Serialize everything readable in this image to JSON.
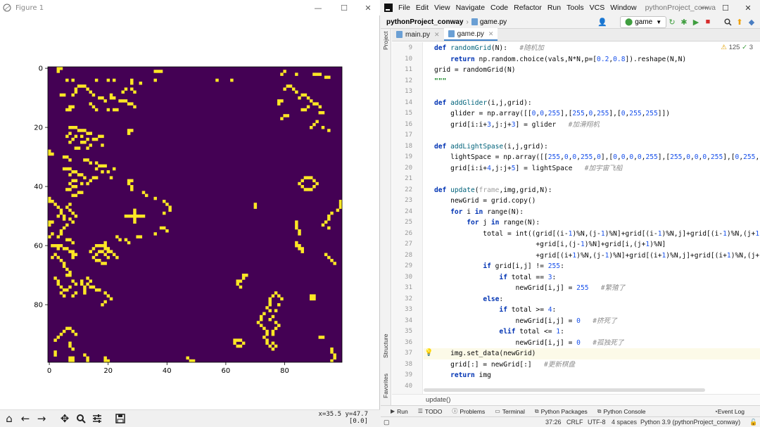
{
  "figure_window": {
    "title": "Figure 1",
    "controls": {
      "minimize": "—",
      "maximize": "☐",
      "close": "✕"
    },
    "toolbar_icons": [
      "home-icon",
      "back-icon",
      "forward-icon",
      "pan-icon",
      "zoom-icon",
      "configure-icon",
      "save-icon"
    ],
    "coords_line1": "x=35.5 y=47.7",
    "coords_line2": "[0.0]"
  },
  "chart_data": {
    "type": "heatmap",
    "description_colors": {
      "dead": "#440154",
      "alive": "#fde725"
    },
    "grid_size": 100,
    "xticks": [
      0,
      20,
      40,
      60,
      80
    ],
    "yticks": [
      0,
      20,
      40,
      60,
      80
    ],
    "xlim": [
      -0.5,
      99.5
    ],
    "ylim": [
      99.5,
      -0.5
    ],
    "alive_cells": [
      [
        0,
        3
      ],
      [
        0,
        4
      ],
      [
        1,
        3
      ],
      [
        4,
        6
      ],
      [
        4,
        8
      ],
      [
        4,
        16
      ],
      [
        4,
        20
      ],
      [
        4,
        22
      ],
      [
        4,
        28
      ],
      [
        4,
        36
      ],
      [
        4,
        57
      ],
      [
        4,
        62
      ],
      [
        1,
        36
      ],
      [
        1,
        37
      ],
      [
        1,
        38
      ],
      [
        1,
        80
      ],
      [
        2,
        79
      ],
      [
        2,
        84
      ],
      [
        2,
        90
      ],
      [
        2,
        91
      ],
      [
        2,
        92
      ],
      [
        3,
        94
      ],
      [
        3,
        95
      ],
      [
        5,
        28
      ],
      [
        5,
        31
      ],
      [
        6,
        10
      ],
      [
        6,
        11
      ],
      [
        6,
        12
      ],
      [
        7,
        9
      ],
      [
        7,
        13
      ],
      [
        7,
        26
      ],
      [
        7,
        28
      ],
      [
        8,
        9
      ],
      [
        8,
        14
      ],
      [
        8,
        25
      ],
      [
        8,
        29
      ],
      [
        9,
        4
      ],
      [
        9,
        5
      ],
      [
        9,
        8
      ],
      [
        9,
        15
      ],
      [
        9,
        21
      ],
      [
        10,
        17
      ],
      [
        10,
        18
      ],
      [
        10,
        21
      ],
      [
        10,
        22
      ],
      [
        11,
        19
      ],
      [
        11,
        24
      ],
      [
        11,
        25
      ],
      [
        11,
        26
      ],
      [
        12,
        14
      ],
      [
        12,
        27
      ],
      [
        12,
        28
      ],
      [
        13,
        7
      ],
      [
        13,
        8
      ],
      [
        13,
        15
      ],
      [
        13,
        29
      ],
      [
        14,
        6
      ],
      [
        14,
        7
      ],
      [
        14,
        16
      ],
      [
        14,
        20
      ],
      [
        14,
        22
      ],
      [
        14,
        23
      ],
      [
        6,
        81
      ],
      [
        6,
        82
      ],
      [
        7,
        80
      ],
      [
        7,
        83
      ],
      [
        8,
        84
      ],
      [
        9,
        86
      ],
      [
        9,
        87
      ],
      [
        10,
        85
      ],
      [
        10,
        88
      ],
      [
        11,
        78
      ],
      [
        11,
        79
      ],
      [
        11,
        89
      ],
      [
        12,
        78
      ],
      [
        12,
        90
      ],
      [
        12,
        91
      ],
      [
        13,
        88
      ],
      [
        13,
        92
      ],
      [
        14,
        87
      ],
      [
        14,
        86
      ],
      [
        15,
        92
      ],
      [
        15,
        93
      ],
      [
        16,
        80
      ],
      [
        16,
        81
      ],
      [
        17,
        79
      ],
      [
        20,
        7
      ],
      [
        20,
        8
      ],
      [
        20,
        9
      ],
      [
        21,
        10
      ],
      [
        21,
        11
      ],
      [
        21,
        12
      ],
      [
        22,
        7
      ],
      [
        22,
        13
      ],
      [
        22,
        14
      ],
      [
        23,
        6
      ],
      [
        23,
        9
      ],
      [
        23,
        11
      ],
      [
        24,
        8
      ],
      [
        24,
        13
      ],
      [
        24,
        15
      ],
      [
        24,
        16
      ],
      [
        25,
        7
      ],
      [
        25,
        11
      ],
      [
        25,
        12
      ],
      [
        26,
        14
      ],
      [
        26,
        18
      ],
      [
        27,
        9
      ],
      [
        27,
        10
      ],
      [
        27,
        13
      ],
      [
        21,
        27
      ],
      [
        21,
        28
      ],
      [
        22,
        27
      ],
      [
        23,
        17
      ],
      [
        23,
        18
      ],
      [
        18,
        91
      ],
      [
        19,
        90
      ],
      [
        20,
        89
      ],
      [
        20,
        93
      ],
      [
        21,
        95
      ],
      [
        28,
        0
      ],
      [
        29,
        0
      ],
      [
        29,
        1
      ],
      [
        30,
        5
      ],
      [
        30,
        6
      ],
      [
        31,
        7
      ],
      [
        31,
        12
      ],
      [
        31,
        13
      ],
      [
        32,
        14
      ],
      [
        32,
        16
      ],
      [
        33,
        17
      ],
      [
        33,
        18
      ],
      [
        33,
        19
      ],
      [
        34,
        5
      ],
      [
        34,
        6
      ],
      [
        34,
        7
      ],
      [
        34,
        16
      ],
      [
        34,
        22
      ],
      [
        35,
        8
      ],
      [
        35,
        9
      ],
      [
        35,
        18
      ],
      [
        35,
        20
      ],
      [
        36,
        7
      ],
      [
        36,
        10
      ],
      [
        36,
        11
      ],
      [
        37,
        12
      ],
      [
        37,
        15
      ],
      [
        37,
        16
      ],
      [
        37,
        21
      ],
      [
        38,
        8
      ],
      [
        38,
        9
      ],
      [
        38,
        14
      ],
      [
        39,
        7
      ],
      [
        39,
        11
      ],
      [
        39,
        13
      ],
      [
        40,
        8
      ],
      [
        40,
        9
      ],
      [
        41,
        6
      ],
      [
        41,
        7
      ],
      [
        42,
        10
      ],
      [
        42,
        11
      ],
      [
        43,
        8
      ],
      [
        43,
        9
      ],
      [
        37,
        87
      ],
      [
        37,
        88
      ],
      [
        37,
        89
      ],
      [
        38,
        86
      ],
      [
        38,
        90
      ],
      [
        39,
        85
      ],
      [
        39,
        91
      ],
      [
        40,
        86
      ],
      [
        40,
        90
      ],
      [
        41,
        87
      ],
      [
        41,
        88
      ],
      [
        41,
        89
      ],
      [
        38,
        27
      ],
      [
        38,
        28
      ],
      [
        39,
        27
      ],
      [
        40,
        28
      ],
      [
        41,
        28
      ],
      [
        42,
        32
      ],
      [
        43,
        33
      ],
      [
        44,
        36
      ],
      [
        45,
        39
      ],
      [
        46,
        40
      ],
      [
        47,
        41
      ],
      [
        48,
        41
      ],
      [
        49,
        39
      ],
      [
        44,
        0
      ],
      [
        45,
        0
      ],
      [
        45,
        1
      ],
      [
        46,
        2
      ],
      [
        47,
        3
      ],
      [
        48,
        4
      ],
      [
        49,
        4
      ],
      [
        50,
        3
      ],
      [
        50,
        5
      ],
      [
        51,
        5
      ],
      [
        52,
        0
      ],
      [
        52,
        1
      ],
      [
        53,
        0
      ],
      [
        46,
        7
      ],
      [
        47,
        6
      ],
      [
        48,
        7
      ],
      [
        49,
        8
      ],
      [
        50,
        9
      ],
      [
        51,
        7
      ],
      [
        52,
        8
      ],
      [
        53,
        6
      ],
      [
        54,
        5
      ],
      [
        55,
        4
      ],
      [
        56,
        4
      ],
      [
        57,
        3
      ],
      [
        48,
        29
      ],
      [
        49,
        29
      ],
      [
        50,
        29
      ],
      [
        51,
        29
      ],
      [
        52,
        29
      ],
      [
        50,
        26
      ],
      [
        50,
        27
      ],
      [
        50,
        28
      ],
      [
        50,
        30
      ],
      [
        50,
        31
      ],
      [
        50,
        32
      ],
      [
        45,
        99
      ],
      [
        46,
        99
      ],
      [
        47,
        99
      ],
      [
        48,
        98
      ],
      [
        49,
        96
      ],
      [
        50,
        95
      ],
      [
        51,
        95
      ],
      [
        52,
        94
      ],
      [
        53,
        93
      ],
      [
        54,
        95
      ],
      [
        46,
        70
      ],
      [
        47,
        70
      ],
      [
        52,
        84
      ],
      [
        53,
        84
      ],
      [
        54,
        84
      ],
      [
        55,
        85
      ],
      [
        56,
        85
      ],
      [
        54,
        38
      ],
      [
        54,
        39
      ],
      [
        55,
        40
      ],
      [
        56,
        36
      ],
      [
        57,
        30
      ],
      [
        57,
        31
      ],
      [
        58,
        26
      ],
      [
        59,
        27
      ],
      [
        56,
        1
      ],
      [
        57,
        0
      ],
      [
        58,
        6
      ],
      [
        58,
        7
      ],
      [
        59,
        8
      ],
      [
        60,
        1
      ],
      [
        60,
        2
      ],
      [
        60,
        3
      ],
      [
        60,
        4
      ],
      [
        61,
        3
      ],
      [
        61,
        5
      ],
      [
        61,
        6
      ],
      [
        62,
        7
      ],
      [
        62,
        8
      ],
      [
        62,
        17
      ],
      [
        62,
        18
      ],
      [
        63,
        8
      ],
      [
        63,
        9
      ],
      [
        63,
        16
      ],
      [
        63,
        19
      ],
      [
        64,
        8
      ],
      [
        64,
        15
      ],
      [
        64,
        20
      ],
      [
        60,
        16
      ],
      [
        60,
        17
      ],
      [
        60,
        18
      ],
      [
        61,
        15
      ],
      [
        61,
        19
      ],
      [
        62,
        14
      ],
      [
        62,
        20
      ],
      [
        65,
        16
      ],
      [
        65,
        17
      ],
      [
        66,
        18
      ],
      [
        66,
        19
      ],
      [
        57,
        23
      ],
      [
        58,
        24
      ],
      [
        59,
        19
      ],
      [
        60,
        19
      ],
      [
        61,
        20
      ],
      [
        62,
        21
      ],
      [
        63,
        22
      ],
      [
        64,
        23
      ],
      [
        59,
        84
      ],
      [
        60,
        84
      ],
      [
        60,
        85
      ],
      [
        61,
        85
      ],
      [
        61,
        86
      ],
      [
        62,
        86
      ],
      [
        63,
        94
      ],
      [
        64,
        95
      ],
      [
        65,
        96
      ],
      [
        66,
        97
      ],
      [
        63,
        2
      ],
      [
        64,
        1
      ],
      [
        64,
        3
      ],
      [
        65,
        4
      ],
      [
        66,
        5
      ],
      [
        67,
        5
      ],
      [
        68,
        6
      ],
      [
        69,
        7
      ],
      [
        70,
        6
      ],
      [
        70,
        7
      ],
      [
        71,
        2
      ],
      [
        72,
        3
      ],
      [
        72,
        8
      ],
      [
        73,
        3
      ],
      [
        73,
        9
      ],
      [
        74,
        4
      ],
      [
        74,
        7
      ],
      [
        75,
        5
      ],
      [
        75,
        6
      ],
      [
        76,
        4
      ],
      [
        76,
        9
      ],
      [
        77,
        5
      ],
      [
        77,
        8
      ],
      [
        71,
        13
      ],
      [
        72,
        14
      ],
      [
        73,
        13
      ],
      [
        74,
        14
      ],
      [
        74,
        15
      ],
      [
        75,
        16
      ],
      [
        75,
        17
      ],
      [
        76,
        19
      ],
      [
        77,
        20
      ],
      [
        78,
        21
      ],
      [
        79,
        19
      ],
      [
        80,
        18
      ],
      [
        72,
        11
      ],
      [
        73,
        11
      ],
      [
        74,
        12
      ],
      [
        75,
        12
      ],
      [
        76,
        12
      ],
      [
        70,
        66
      ],
      [
        70,
        67
      ],
      [
        71,
        66
      ],
      [
        72,
        64
      ],
      [
        72,
        65
      ],
      [
        73,
        64
      ],
      [
        74,
        65
      ],
      [
        76,
        77
      ],
      [
        77,
        76
      ],
      [
        77,
        78
      ],
      [
        78,
        75
      ],
      [
        78,
        79
      ],
      [
        79,
        75
      ],
      [
        80,
        75
      ],
      [
        80,
        78
      ],
      [
        81,
        74
      ],
      [
        82,
        75
      ],
      [
        82,
        77
      ],
      [
        83,
        73
      ],
      [
        84,
        72
      ],
      [
        84,
        76
      ],
      [
        85,
        72
      ],
      [
        85,
        75
      ],
      [
        86,
        71
      ],
      [
        86,
        77
      ],
      [
        87,
        72
      ],
      [
        87,
        78
      ],
      [
        88,
        73
      ],
      [
        88,
        77
      ],
      [
        89,
        74
      ],
      [
        89,
        76
      ],
      [
        90,
        74
      ],
      [
        90,
        76
      ],
      [
        91,
        73
      ],
      [
        92,
        74
      ],
      [
        93,
        74
      ],
      [
        93,
        76
      ],
      [
        94,
        75
      ],
      [
        94,
        77
      ],
      [
        95,
        76
      ],
      [
        77,
        89
      ],
      [
        77,
        90
      ],
      [
        78,
        89
      ],
      [
        78,
        90
      ],
      [
        91,
        92
      ],
      [
        91,
        93
      ],
      [
        88,
        6
      ],
      [
        88,
        7
      ],
      [
        89,
        5
      ],
      [
        89,
        8
      ],
      [
        90,
        4
      ],
      [
        90,
        9
      ],
      [
        91,
        3
      ],
      [
        92,
        2
      ],
      [
        93,
        7
      ],
      [
        94,
        7
      ],
      [
        95,
        8
      ],
      [
        92,
        63
      ],
      [
        92,
        64
      ],
      [
        92,
        65
      ],
      [
        93,
        63
      ],
      [
        93,
        66
      ],
      [
        94,
        64
      ],
      [
        94,
        65
      ],
      [
        96,
        2
      ],
      [
        97,
        2
      ],
      [
        98,
        7
      ],
      [
        99,
        7
      ],
      [
        98,
        8
      ],
      [
        99,
        8
      ],
      [
        97,
        12
      ],
      [
        98,
        13
      ],
      [
        99,
        13
      ],
      [
        99,
        19
      ],
      [
        99,
        20
      ],
      [
        98,
        19
      ],
      [
        98,
        47
      ],
      [
        99,
        48
      ],
      [
        99,
        49
      ],
      [
        95,
        96
      ],
      [
        96,
        96
      ],
      [
        97,
        97
      ],
      [
        98,
        97
      ],
      [
        99,
        96
      ]
    ]
  },
  "ide": {
    "menu": [
      "File",
      "Edit",
      "View",
      "Navigate",
      "Code",
      "Refactor",
      "Run",
      "Tools",
      "VCS",
      "Window"
    ],
    "project_title": "pythonProject_conwa",
    "nav_project": "pythonProject_conway",
    "nav_file": "game.py",
    "run_config": "game",
    "left_strip_labels": {
      "project": "Project",
      "structure": "Structure",
      "favorites": "Favorites"
    },
    "tabs": [
      {
        "label": "main.py",
        "active": false
      },
      {
        "label": "game.py",
        "active": true
      }
    ],
    "inspection": {
      "warnings": "125",
      "weak": "3"
    },
    "line_numbers": [
      "9",
      "10",
      "11",
      "12",
      "13",
      "14",
      "15",
      "16",
      "17",
      "18",
      "19",
      "20",
      "21",
      "22",
      "23",
      "24",
      "25",
      "26",
      "27",
      "28",
      "29",
      "30",
      "31",
      "32",
      "33",
      "34",
      "35",
      "36",
      "37",
      "38",
      "39",
      "40"
    ],
    "breadcrumb": "update()",
    "tool_windows": [
      "Run",
      "TODO",
      "Problems",
      "Terminal",
      "Python Packages",
      "Python Console"
    ],
    "event_log": "Event Log",
    "status": {
      "position": "37:26",
      "line_sep": "CRLF",
      "encoding": "UTF-8",
      "indent": "4 spaces",
      "interpreter": "Python 3.9 (pythonProject_conway)"
    }
  },
  "colors": {
    "keyword": "#0033b3",
    "string": "#067d17",
    "number": "#1750eb",
    "comment": "#8c8c8c",
    "current_line": "#fcfae8"
  }
}
